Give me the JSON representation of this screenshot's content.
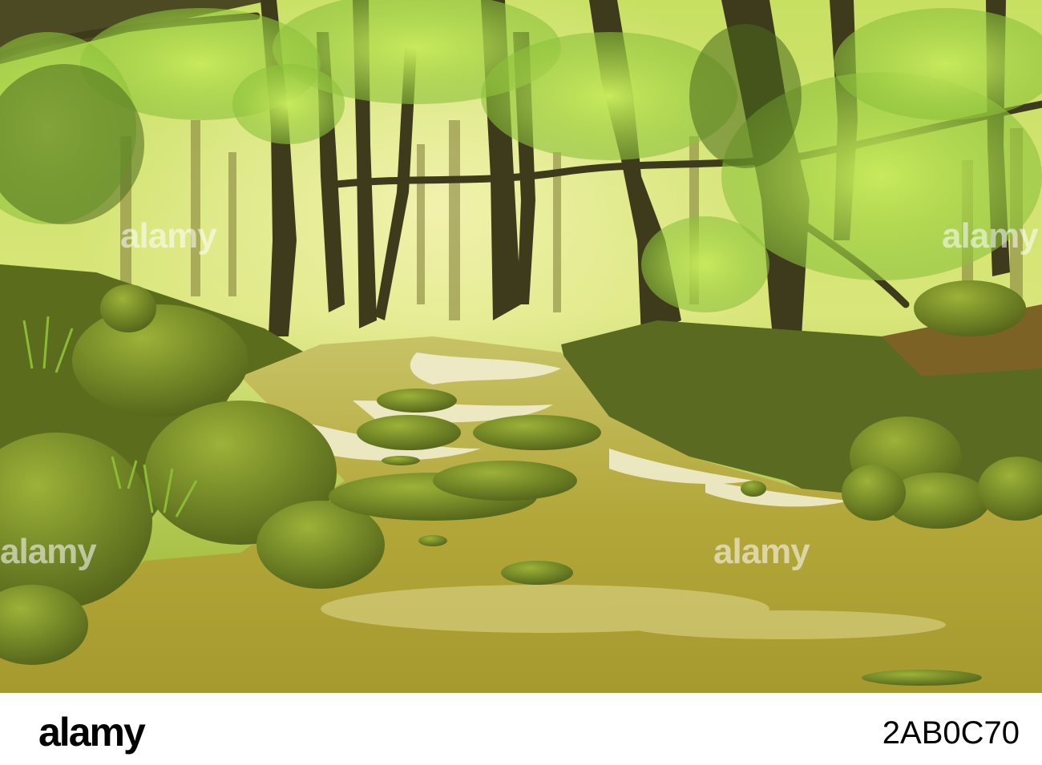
{
  "photo": {
    "subject": "woodland",
    "palette": {
      "canopy": "#b7d64a",
      "trunk": "#3e3a1c",
      "moss": "#6f8a22",
      "water": "#b6ad3c",
      "foam": "#f4f1d6"
    }
  },
  "watermark": {
    "text": "alamy"
  },
  "footer": {
    "logo_text": "alamy",
    "image_id": "2AB0C70"
  }
}
